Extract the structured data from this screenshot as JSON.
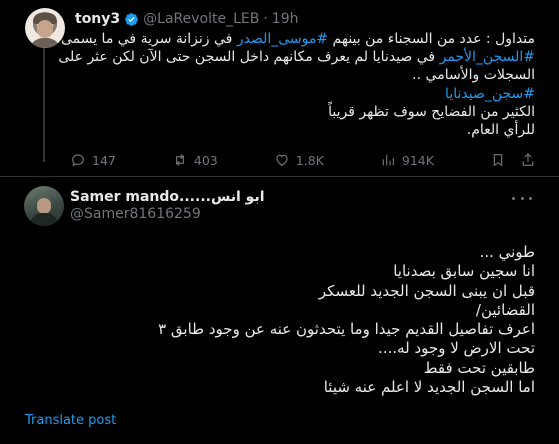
{
  "original_tweet": {
    "display_name": "tony3",
    "handle": "@LaRevolte_LEB",
    "separator": "·",
    "time": "19h",
    "lines": [
      [
        {
          "t": "متداول : عدد من السجناء من بينهم ",
          "tag": false
        },
        {
          "t": "#موسى_الصدر",
          "tag": true
        },
        {
          "t": " في زنزانة سرية في ما يسمى",
          "tag": false
        }
      ],
      [
        {
          "t": "#السجن_الأحمر",
          "tag": true
        },
        {
          "t": "  في صيدنايا لم يعرف مكانهم داخل السجن حتى الآن لكن عثر على",
          "tag": false
        }
      ],
      [
        {
          "t": "السجلات والأسامي ..",
          "tag": false
        }
      ],
      [
        {
          "t": "#سجن_صيدنايا",
          "tag": true
        }
      ],
      [
        {
          "t": "الكثير من الفضايح سوف تظهر قريباً",
          "tag": false
        }
      ],
      [
        {
          "t": "للرأي العام.",
          "tag": false
        }
      ]
    ],
    "stats": {
      "replies": "147",
      "reposts": "403",
      "likes": "1.8K",
      "views": "914K"
    }
  },
  "reply": {
    "display_name": "ابو انس......Samer mando",
    "handle": "@Samer81616259",
    "lines": [
      "طوني ...",
      "انا سجين سابق بصدنايا",
      "قبل ان يبنى السجن الجديد للعسكر",
      "القضائين/",
      "اعرف تفاصيل القديم جيدا وما يتحدثون عنه عن وجود طابق ٣",
      "تحت الارض لا وجود له....",
      "طابقين تحت فقط",
      "اما السجن الجديد لا اعلم عنه شيئا"
    ],
    "translate_label": "Translate post"
  },
  "colors": {
    "background": "#000000",
    "text": "#e7e9ea",
    "muted": "#71767b",
    "accent": "#1d9bf0",
    "divider": "#2f3336"
  },
  "icons": [
    "verified-badge-icon",
    "reply-icon",
    "repost-icon",
    "like-icon",
    "views-icon",
    "bookmark-icon",
    "share-icon",
    "more-icon"
  ]
}
